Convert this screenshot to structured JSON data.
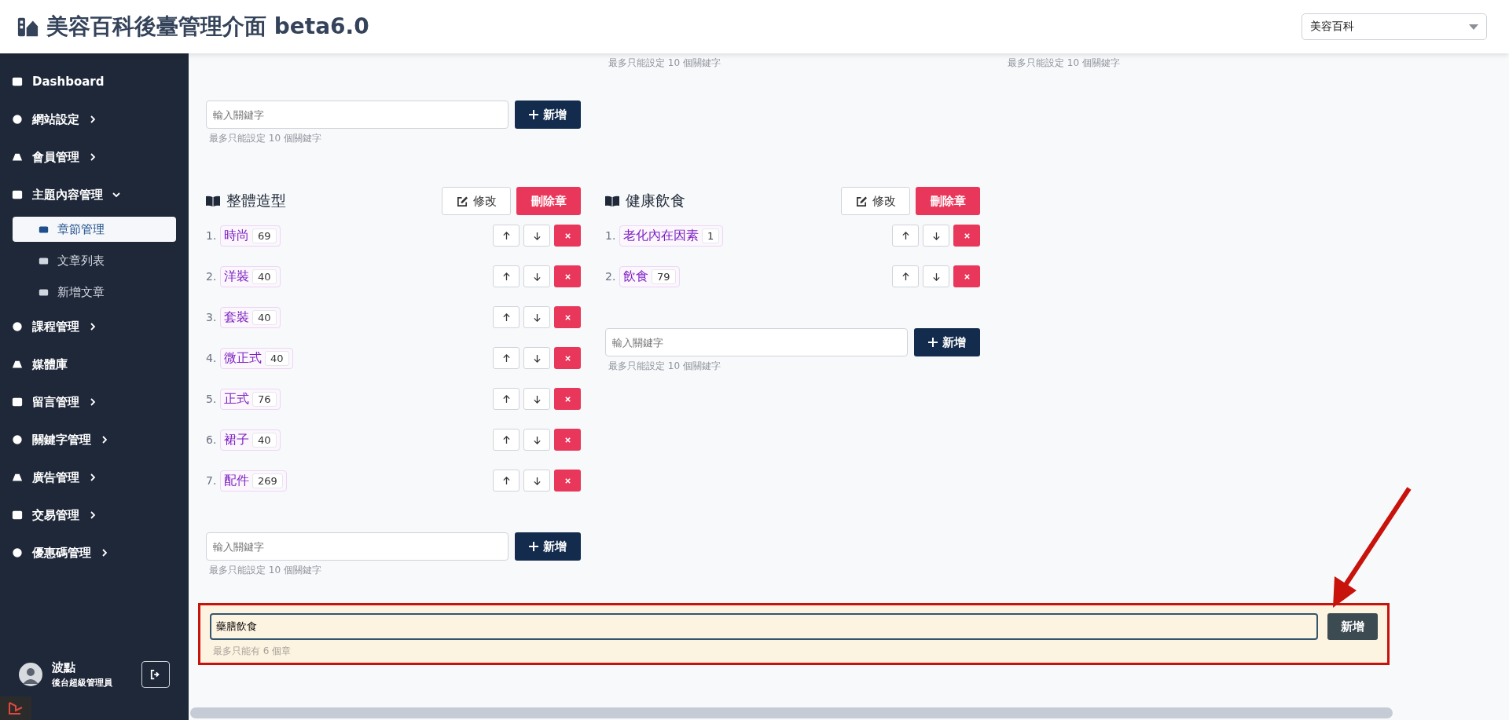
{
  "header": {
    "title": "美容百科後臺管理介面 beta6.0",
    "site_select": {
      "value": "美容百科"
    }
  },
  "sidebar": {
    "items": [
      {
        "label": "Dashboard"
      },
      {
        "label": "網站設定",
        "expanded": false
      },
      {
        "label": "會員管理",
        "expanded": false
      },
      {
        "label": "主題內容管理",
        "expanded": true,
        "children": [
          {
            "label": "章節管理",
            "selected": true
          },
          {
            "label": "文章列表",
            "selected": false
          },
          {
            "label": "新增文章",
            "selected": false
          }
        ]
      },
      {
        "label": "課程管理",
        "expanded": false
      },
      {
        "label": "媒體庫"
      },
      {
        "label": "留言管理",
        "expanded": false
      },
      {
        "label": "關鍵字管理",
        "expanded": false
      },
      {
        "label": "廣告管理",
        "expanded": false
      },
      {
        "label": "交易管理",
        "expanded": false
      },
      {
        "label": "優惠碼管理",
        "expanded": false
      }
    ],
    "user": {
      "name": "波點",
      "role": "後台超級管理員"
    }
  },
  "chapter_columns_above": [
    {
      "keyword_input": {
        "placeholder": "輸入關鍵字"
      },
      "add_button": "新增",
      "hint": "最多只能設定 10 個關鍵字"
    },
    {
      "hint": "最多只能設定 10 個關鍵字"
    },
    {
      "hint": "最多只能設定 10 個關鍵字"
    }
  ],
  "chapters": [
    {
      "title": "整體造型",
      "edit_button": "修改",
      "delete_button": "刪除章",
      "keywords": [
        {
          "number": "1.",
          "name": "時尚",
          "count": "69"
        },
        {
          "number": "2.",
          "name": "洋裝",
          "count": "40"
        },
        {
          "number": "3.",
          "name": "套裝",
          "count": "40"
        },
        {
          "number": "4.",
          "name": "微正式",
          "count": "40"
        },
        {
          "number": "5.",
          "name": "正式",
          "count": "76"
        },
        {
          "number": "6.",
          "name": "裙子",
          "count": "40"
        },
        {
          "number": "7.",
          "name": "配件",
          "count": "269"
        }
      ],
      "keyword_input": {
        "placeholder": "輸入關鍵字"
      },
      "add_button": "新增",
      "hint": "最多只能設定 10 個關鍵字"
    },
    {
      "title": "健康飲食",
      "edit_button": "修改",
      "delete_button": "刪除章",
      "keywords": [
        {
          "number": "1.",
          "name": "老化內在因素",
          "count": "1"
        },
        {
          "number": "2.",
          "name": "飲食",
          "count": "79"
        }
      ],
      "keyword_input": {
        "placeholder": "輸入關鍵字"
      },
      "add_button": "新增",
      "hint": "最多只能設定 10 個關鍵字"
    }
  ],
  "new_chapter": {
    "value": "藥膳飲食",
    "add_button": "新增",
    "hint": "最多只能有 6 個章",
    "highlighted": true
  }
}
